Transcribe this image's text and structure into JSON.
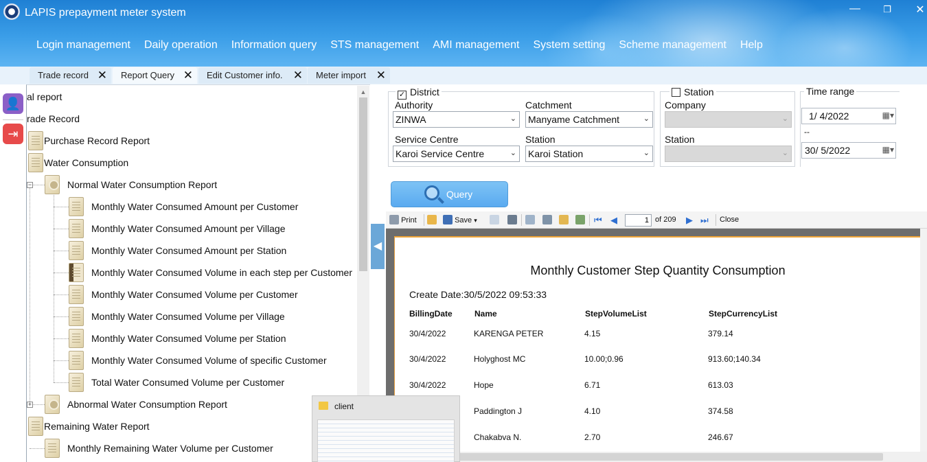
{
  "app": {
    "title": "LAPIS prepayment meter system",
    "window_controls": [
      "—",
      "❐",
      "✕"
    ]
  },
  "menu": [
    "Login management",
    "Daily operation",
    "Information query",
    "STS management",
    "AMI management",
    "System setting",
    "Scheme management",
    "Help"
  ],
  "tabs": [
    {
      "label": "Trade record",
      "active": false
    },
    {
      "label": "Report Query",
      "active": true
    },
    {
      "label": "Edit Customer info.",
      "active": false
    },
    {
      "label": "Meter import",
      "active": false
    }
  ],
  "tree": {
    "items": [
      {
        "label": "al report"
      },
      {
        "label": "rade Record"
      },
      {
        "label": "Purchase Record Report"
      },
      {
        "label": "Water Consumption"
      },
      {
        "label": "Normal Water Consumption Report"
      },
      {
        "label": "Monthly Water Consumed Amount per Customer"
      },
      {
        "label": "Monthly Water Consumed Amount per Village"
      },
      {
        "label": "Monthly Water Consumed Amount per Station"
      },
      {
        "label": "Monthly Water Consumed Volume in each step per Customer"
      },
      {
        "label": "Monthly Water Consumed Volume per Customer"
      },
      {
        "label": "Monthly Water Consumed Volume per Village"
      },
      {
        "label": "Monthly Water Consumed Volume per Station"
      },
      {
        "label": "Monthly Water Consumed Volume of specific Customer"
      },
      {
        "label": "Total Water Consumed Volume per Customer"
      },
      {
        "label": "Abnormal Water Consumption Report"
      },
      {
        "label": "Remaining Water Report"
      },
      {
        "label": "Monthly Remaining Water Volume per Customer"
      }
    ]
  },
  "filters": {
    "district": {
      "label": "District",
      "checked": true,
      "check_mark": "✓"
    },
    "authority": {
      "label": "Authority",
      "value": "ZINWA"
    },
    "catchment": {
      "label": "Catchment",
      "value": "Manyame Catchment"
    },
    "service_centre": {
      "label": "Service Centre",
      "value": "Karoi Service Centre"
    },
    "station": {
      "label": "Station",
      "value": "Karoi Station"
    },
    "station_group": {
      "label": "Station",
      "checked": false
    },
    "company": {
      "label": "Company",
      "value": ""
    },
    "station2": {
      "label": "Station",
      "value": ""
    },
    "time_range": {
      "label": "Time range",
      "from": "1/  4/2022",
      "separator": "--",
      "to": "30/  5/2022"
    }
  },
  "query_button": "Query",
  "toolbar": {
    "print": "Print",
    "save": "Save",
    "page": "1",
    "of_pages": "of 209",
    "close": "Close"
  },
  "report": {
    "title": "Monthly Customer Step Quantity Consumption",
    "create_date": "Create Date:30/5/2022 09:53:33",
    "columns": [
      "BillingDate",
      "Name",
      "StepVolumeList",
      "StepCurrencyList"
    ],
    "rows": [
      [
        "30/4/2022",
        "KARENGA PETER",
        "4.15",
        "379.14"
      ],
      [
        "30/4/2022",
        "Holyghost MC",
        "10.00;0.96",
        "913.60;140.34"
      ],
      [
        "30/4/2022",
        "Hope",
        "6.71",
        "613.03"
      ],
      [
        "",
        "Paddington J",
        "4.10",
        "374.58"
      ],
      [
        "",
        "Chakabva N.",
        "2.70",
        "246.67"
      ]
    ]
  },
  "taskbar_popup": {
    "title": "client"
  },
  "colors": {
    "header": "#2d8fdf",
    "accent_orange": "#f0a437",
    "query_button": "#6bb6f2"
  }
}
